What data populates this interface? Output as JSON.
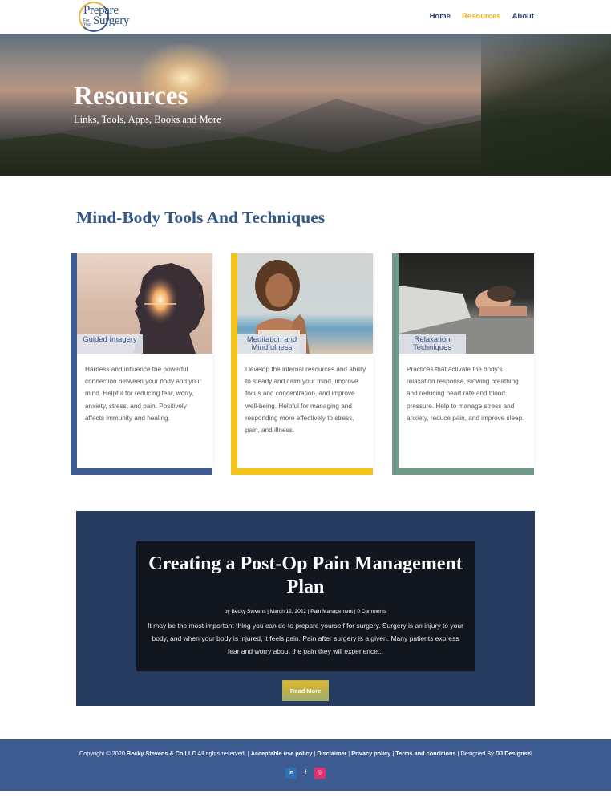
{
  "header": {
    "logo": {
      "line1": "Prepare",
      "line2": "Surgery",
      "small": "For Your"
    },
    "nav": [
      {
        "label": "Home",
        "active": false
      },
      {
        "label": "Resources",
        "active": true
      },
      {
        "label": "About",
        "active": false
      }
    ]
  },
  "hero": {
    "title": "Resources",
    "subtitle": "Links, Tools, Apps, Books and More"
  },
  "section": {
    "title": "Mind-Body Tools And Techniques"
  },
  "cards": [
    {
      "label": "Guided Imagery",
      "accent": "#3d5a91",
      "desc": "Harness and influence the powerful connection between your body and your mind. Helpful for reducing fear, worry, anxiety, stress, and pain. Positively affects immunity and healing."
    },
    {
      "label": "Meditation and Mindfulness",
      "accent": "#f2c21b",
      "desc": "Develop the internal resources and ability to steady and calm your mind, improve focus and concentration, and improve well-being. Helpful for managing and responding more effectively to stress, pain, and illness."
    },
    {
      "label": "Relaxation Techniques",
      "accent": "#6f9a87",
      "desc": "Practices that activate the body's relaxation response, slowing breathing and reducing heart rate and blood pressure. Help to manage stress and anxiety, reduce pain, and improve sleep."
    }
  ],
  "blog": {
    "title": "Creating a Post-Op Pain Management Plan",
    "meta": "by Becky Stevens | March 12, 2022 | Pain Management | 0 Comments",
    "excerpt": "It may be the most important thing you can do to prepare yourself for surgery. Surgery is an injury to your body, and when your body is injured, it feels pain. Pain after surgery is a given. Many patients express fear and worry about the pain they will experience...",
    "button": "Read More"
  },
  "footer": {
    "copyright_prefix": "Copyright © 2020",
    "company": "Becky Stevens & Co LLC",
    "rights": "All rights reserved. |",
    "links": [
      "Acceptable use policy",
      "Disclaimer",
      "Privacy policy",
      "Terms and conditions"
    ],
    "designed_prefix": "| Designed By",
    "designer": "DJ Designs®",
    "social": [
      {
        "icon": "linkedin-icon",
        "glyph": "in"
      },
      {
        "icon": "facebook-icon",
        "glyph": "f"
      },
      {
        "icon": "instagram-icon",
        "glyph": "◎"
      }
    ]
  },
  "colors": {
    "brand_blue": "#3d5a91",
    "accent_yellow": "#e8b524",
    "blog_bg": "#263b5e"
  }
}
